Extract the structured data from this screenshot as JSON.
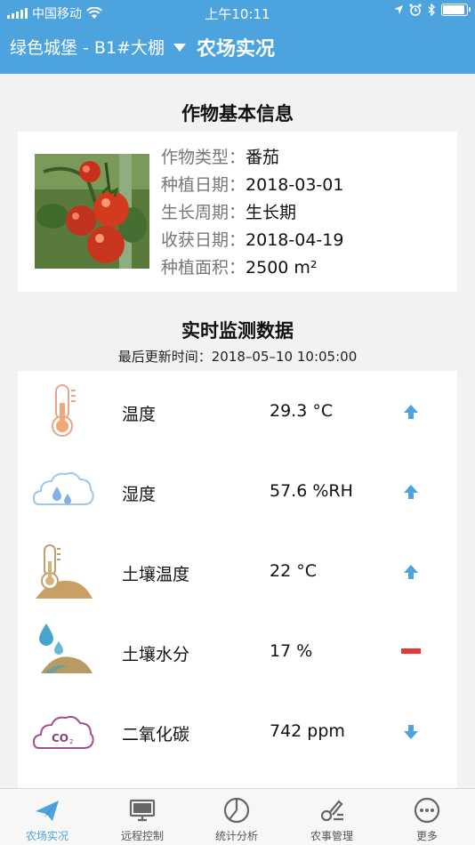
{
  "status_bar": {
    "carrier": "中国移动",
    "time": "上午10:11",
    "battery_level": 0.85
  },
  "nav": {
    "farm_selector": "绿色城堡 - B1#大棚",
    "title": "农场实况"
  },
  "crop_info": {
    "heading": "作物基本信息",
    "fields": [
      {
        "label": "作物类型：",
        "value": "番茄"
      },
      {
        "label": "种植日期：",
        "value": "2018-03-01"
      },
      {
        "label": "生长周期：",
        "value": "生长期"
      },
      {
        "label": "收获日期：",
        "value": "2018-04-19"
      },
      {
        "label": "种植面积：",
        "value": "2500 m²"
      }
    ]
  },
  "monitor": {
    "heading": "实时监测数据",
    "updated": "最后更新时间：2018–05–10 10:05:00",
    "rows": [
      {
        "name": "温度",
        "value": "29.3 °C",
        "trend": "up",
        "icon": "thermometer-icon"
      },
      {
        "name": "湿度",
        "value": "57.6 %RH",
        "trend": "up",
        "icon": "humidity-cloud-icon"
      },
      {
        "name": "土壤温度",
        "value": "22 °C",
        "trend": "up",
        "icon": "soil-temperature-icon"
      },
      {
        "name": "土壤水分",
        "value": "17 %",
        "trend": "flat",
        "icon": "soil-moisture-icon"
      },
      {
        "name": "二氧化碳",
        "value": "742 ppm",
        "trend": "down",
        "icon": "co2-cloud-icon"
      }
    ]
  },
  "tabs": [
    {
      "label": "农场实况",
      "icon": "paper-plane-icon",
      "active": true
    },
    {
      "label": "远程控制",
      "icon": "monitor-icon",
      "active": false
    },
    {
      "label": "统计分析",
      "icon": "pie-chart-icon",
      "active": false
    },
    {
      "label": "农事管理",
      "icon": "tools-icon",
      "active": false
    },
    {
      "label": "更多",
      "icon": "more-icon",
      "active": false
    }
  ],
  "colors": {
    "primary": "#4da3dd",
    "trend_up": "#4da3dd",
    "trend_flat": "#e53935",
    "trend_down": "#4da3dd"
  }
}
